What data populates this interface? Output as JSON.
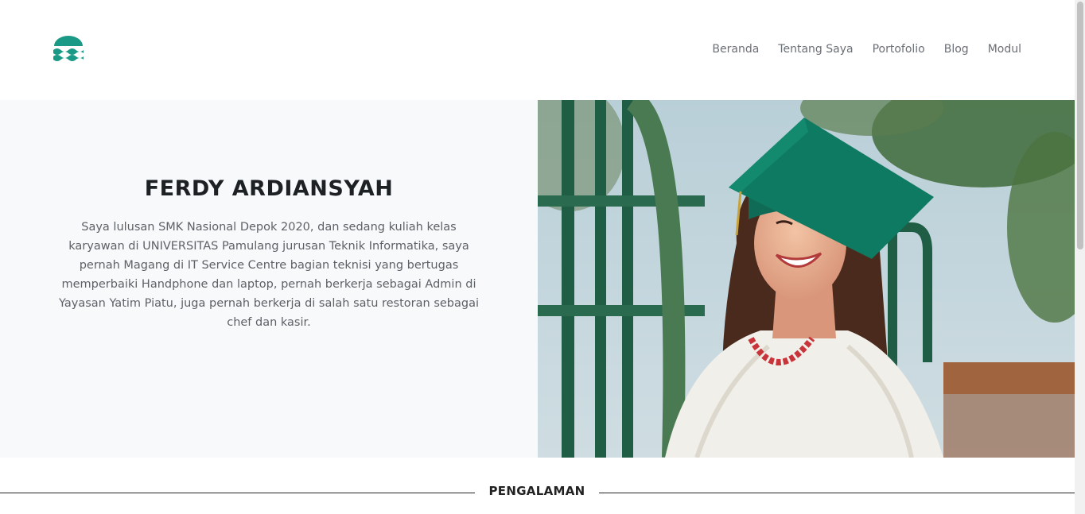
{
  "header": {
    "logo_icon": "waves-logo-icon",
    "brand_color": "#1a9a86",
    "nav": [
      "Beranda",
      "Tentang Saya",
      "Portofolio",
      "Blog",
      "Modul"
    ]
  },
  "hero": {
    "title": "FERDY ARDIANSYAH",
    "description": "Saya lulusan SMK Nasional Depok 2020, dan sedang kuliah kelas karyawan di UNIVERSITAS Pamulang jurusan Teknik Informatika, saya pernah Magang di IT Service Centre bagian teknisi yang bertugas memperbaiki Handphone dan laptop, pernah berkerja sebagai Admin di Yayasan Yatim Piatu, juga pernah berkerja di salah satu restoran sebagai chef dan kasir.",
    "photo_icon": "graduate-photo"
  },
  "section": {
    "title": "PENGALAMAN"
  },
  "colors": {
    "hero_bg": "#f8f9fa",
    "title_text": "#1d2124",
    "body_text": "#5d6166",
    "nav_text": "#6b6f76"
  }
}
